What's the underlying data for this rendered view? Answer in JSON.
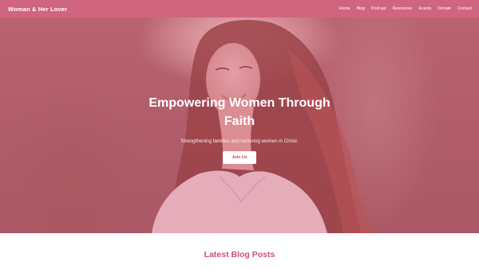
{
  "navbar": {
    "brand": "Woman & Her Lover",
    "links": [
      "Home",
      "Blog",
      "Podcast",
      "Resources",
      "Events",
      "Donate",
      "Contact"
    ]
  },
  "hero": {
    "title": "Empowering Women Through Faith",
    "subtitle": "Strengthening families and nurturing women in Christ.",
    "button": "Join Us"
  },
  "blog_section": {
    "title": "Latest Blog Posts"
  },
  "colors": {
    "primary_pink": "#d0657f",
    "overlay_pink": "#c84b6e",
    "heading_pink": "#cc4f75",
    "white": "#ffffff"
  }
}
